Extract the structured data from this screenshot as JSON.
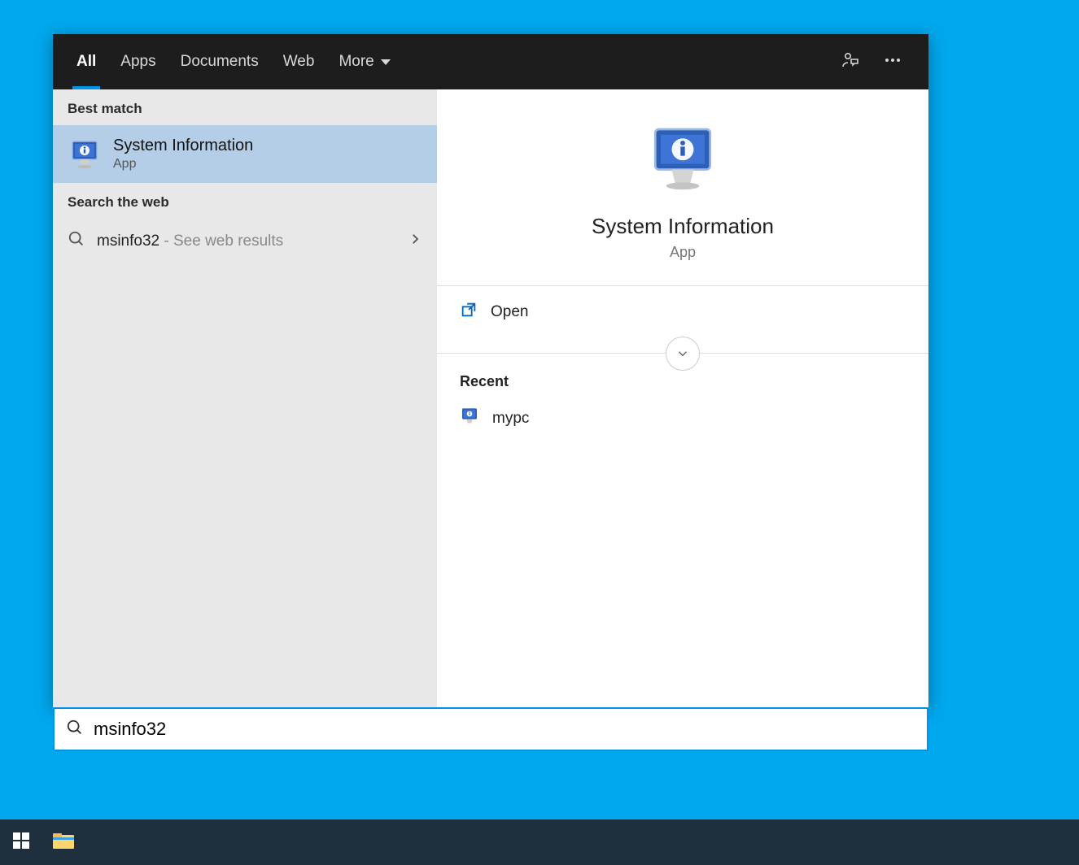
{
  "tabs": {
    "all": "All",
    "apps": "Apps",
    "documents": "Documents",
    "web": "Web",
    "more": "More"
  },
  "left": {
    "bestMatchLabel": "Best match",
    "bestMatch": {
      "title": "System Information",
      "subtitle": "App"
    },
    "searchWebLabel": "Search the web",
    "webResult": {
      "term": "msinfo32",
      "hint": " - See web results"
    }
  },
  "preview": {
    "title": "System Information",
    "subtitle": "App",
    "openLabel": "Open",
    "recentLabel": "Recent",
    "recentItems": [
      {
        "name": "mypc"
      }
    ]
  },
  "search": {
    "value": "msinfo32"
  }
}
